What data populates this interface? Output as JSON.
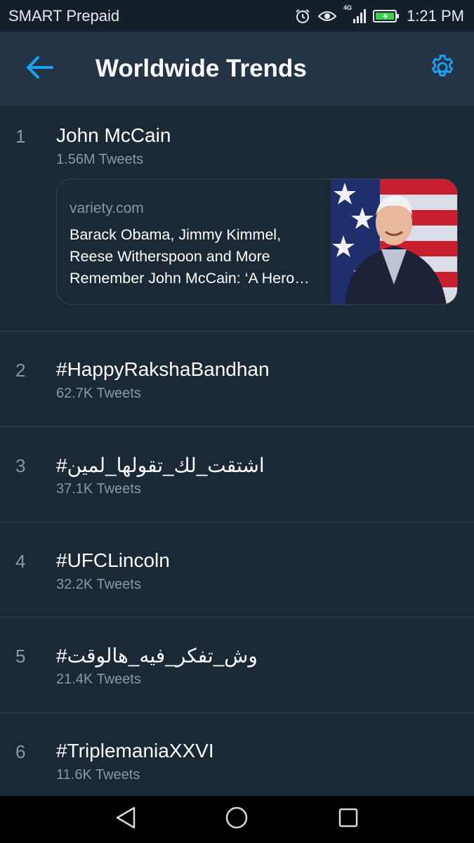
{
  "status_bar": {
    "carrier": "SMART Prepaid",
    "network": "4G",
    "time": "1:21 PM",
    "icons": [
      "alarm-icon",
      "eye-icon",
      "signal-icon",
      "battery-icon"
    ]
  },
  "header": {
    "title": "Worldwide Trends",
    "back_icon": "arrow-left-icon",
    "settings_icon": "gear-icon",
    "accent_color": "#1da1f2"
  },
  "trends": [
    {
      "rank": "1",
      "name": "John McCain",
      "count": "1.56M Tweets",
      "card": {
        "domain": "variety.com",
        "headline": "Barack Obama, Jimmy Kimmel, Reese Witherspoon and More Remember John McCain: ‘A Hero…"
      }
    },
    {
      "rank": "2",
      "name": "#HappyRakshaBandhan",
      "count": "62.7K Tweets"
    },
    {
      "rank": "3",
      "name": "#اشتقت_لك_تقولها_لمين",
      "count": "37.1K Tweets"
    },
    {
      "rank": "4",
      "name": "#UFCLincoln",
      "count": "32.2K Tweets"
    },
    {
      "rank": "5",
      "name": "#وش_تفكر_فيه_هالوقت",
      "count": "21.4K Tweets"
    },
    {
      "rank": "6",
      "name": "#TriplemaniaXXVI",
      "count": "11.6K Tweets"
    }
  ],
  "nav_bar": {
    "icons": [
      "back-triangle-icon",
      "home-circle-icon",
      "recents-square-icon"
    ]
  }
}
